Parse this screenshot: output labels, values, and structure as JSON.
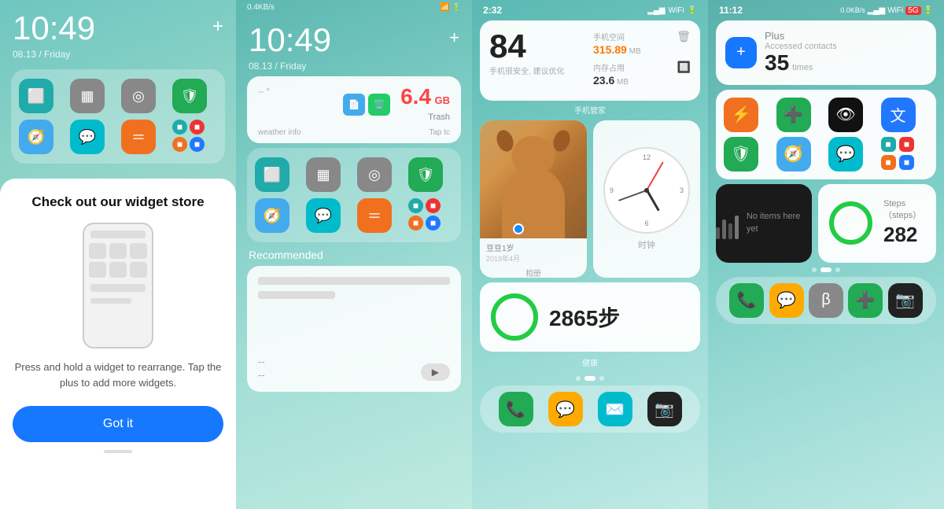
{
  "panel1": {
    "time": "10:49",
    "date": "08.13 / Friday",
    "plus_icon": "+",
    "sheet": {
      "title": "Check out our widget store",
      "description": "Press and hold a widget to rearrange. Tap the plus to add more widgets.",
      "got_it": "Got it"
    }
  },
  "panel2": {
    "time": "10:49",
    "date": "08.13 / Friday",
    "plus_icon": "+",
    "status_bar": "0.4KB/s",
    "trash_size": "6.4",
    "trash_unit": "GB",
    "trash_label": "Trash",
    "weather_label": "weather info",
    "tap_label": "Tap tc",
    "recommended_label": "Recommended"
  },
  "panel3": {
    "time": "2:32",
    "health_score": "84",
    "health_score_sub": "手机很安全, 建议优化",
    "metric1_label": "手机空间",
    "metric1_val": "315.89",
    "metric1_unit": "MB",
    "metric2_label": "内存占用",
    "metric2_val": "23.6",
    "metric2_unit": "MB",
    "health_footer": "手机管家",
    "dog_year": "豆豆1岁",
    "dog_date": "2019年4月",
    "photo_footer": "相册",
    "clock_footer": "时钟",
    "steps_count": "2865步",
    "steps_footer": "健康"
  },
  "panel4": {
    "time": "11:12",
    "status_bar": "0.0KB/s",
    "contacts_label": "Plus\nAccessed contacts",
    "contacts_count": "35",
    "contacts_unit": "times",
    "no_items_text": "No items here yet",
    "steps_count": "282",
    "steps_label": "Steps（steps）"
  }
}
